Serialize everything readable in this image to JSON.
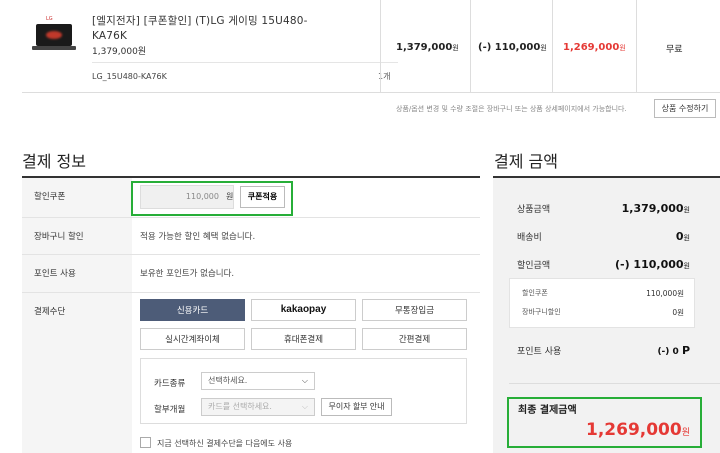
{
  "product": {
    "name": "[엘지전자] [쿠폰할인] (T)LG 게이밍 15U480-KA76K",
    "price": "1,379,000원",
    "option": "LG_15U480-KA76K",
    "quantity": "1개",
    "brand_mark": "LG",
    "col_price": "1,379,000",
    "col_discount": "(-) 110,000",
    "col_total": "1,269,000",
    "won": "원",
    "shipping": "무료"
  },
  "notice": {
    "text": "상품/옵션 변경 및 수량 조절은 장바구니 또는 상품 상세페이지에서 가능합니다.",
    "modify_button": "상품 수정하기"
  },
  "payment_info": {
    "title": "결제 정보",
    "coupon_label": "할인쿠폰",
    "coupon_value": "110,000",
    "coupon_unit": "원",
    "coupon_button": "쿠폰적용",
    "cart_discount_label": "장바구니 할인",
    "cart_discount_text": "적용 가능한 할인 혜택 없습니다.",
    "points_label": "포인트 사용",
    "points_text": "보유한 포인트가 없습니다.",
    "method_label": "결제수단",
    "methods": [
      "신용카드",
      "kakaopay",
      "무통장입금",
      "실시간계좌이체",
      "휴대폰결제",
      "간편결제"
    ],
    "card_type_label": "카드종류",
    "card_type_placeholder": "선택하세요.",
    "installment_label": "할부개월",
    "installment_placeholder": "카드를 선택하세요.",
    "no_interest_button": "무이자 할부 안내",
    "remember_label": "지금 선택하신 결제수단을 다음에도 사용"
  },
  "payment_amount": {
    "title": "결제 금액",
    "product_amount_label": "상품금액",
    "product_amount": "1,379,000",
    "shipping_label": "배송비",
    "shipping": "0",
    "discount_label": "할인금액",
    "discount": "(-) 110,000",
    "sub_coupon_label": "할인쿠폰",
    "sub_coupon": "110,000",
    "sub_cart_label": "장바구니할인",
    "sub_cart": "0",
    "points_label": "포인트 사용",
    "points": "(-) 0",
    "points_unit": "P",
    "final_label": "최종 결제금액",
    "final": "1,269,000",
    "won": "원"
  },
  "colors": {
    "accent_red": "#e53935",
    "highlight_green": "#27ae38",
    "active_method": "#4d5c78"
  }
}
